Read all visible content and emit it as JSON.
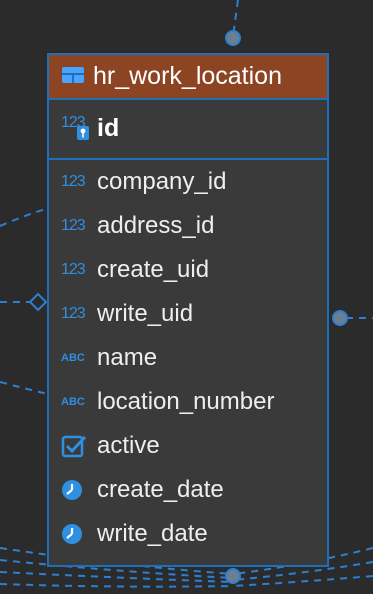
{
  "table": {
    "name": "hr_work_location",
    "primary_key": {
      "label": "id",
      "type_glyph": "123",
      "icon": "primary-key-icon"
    },
    "columns": [
      {
        "label": "company_id",
        "type_glyph": "123",
        "icon": "numeric-type-icon"
      },
      {
        "label": "address_id",
        "type_glyph": "123",
        "icon": "numeric-type-icon"
      },
      {
        "label": "create_uid",
        "type_glyph": "123",
        "icon": "numeric-type-icon"
      },
      {
        "label": "write_uid",
        "type_glyph": "123",
        "icon": "numeric-type-icon"
      },
      {
        "label": "name",
        "type_glyph": "ABC",
        "icon": "text-type-icon"
      },
      {
        "label": "location_number",
        "type_glyph": "ABC",
        "icon": "text-type-icon"
      },
      {
        "label": "active",
        "type_glyph": "",
        "icon": "boolean-checkbox-icon"
      },
      {
        "label": "create_date",
        "type_glyph": "",
        "icon": "datetime-clock-icon"
      },
      {
        "label": "write_date",
        "type_glyph": "",
        "icon": "datetime-clock-icon"
      }
    ]
  },
  "colors": {
    "canvas": "#2b2b2b",
    "entity_body": "#3a3a3a",
    "header": "#8c4423",
    "border": "#1f6fb8",
    "type_icon": "#2f8fe0",
    "link_line": "#2f7fd0",
    "text": "#eeeeee"
  }
}
